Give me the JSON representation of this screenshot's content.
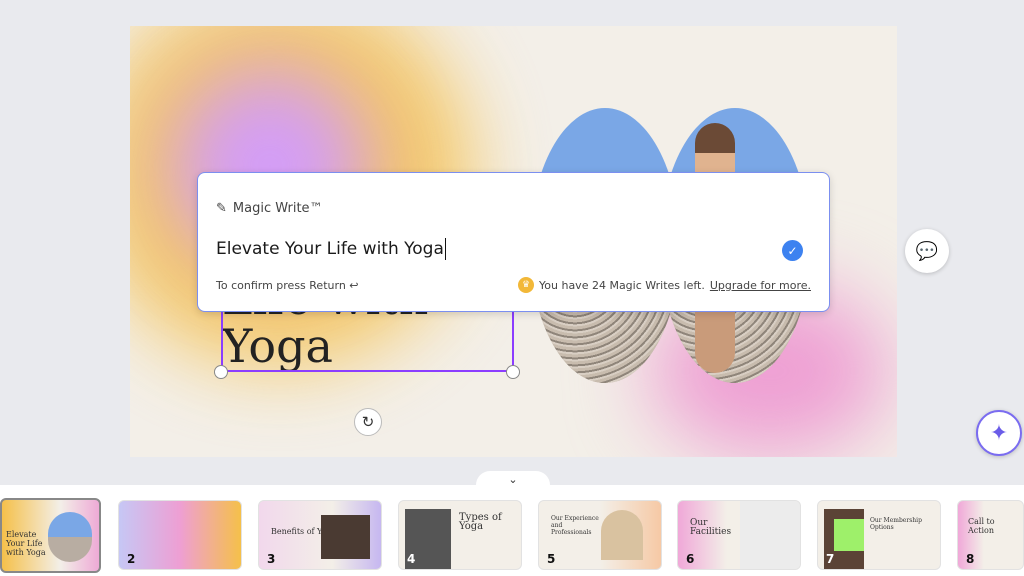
{
  "slide": {
    "title_partial": "Life with",
    "title_last": "Yoga"
  },
  "magic_write": {
    "label": "Magic Write™",
    "input_value": "Elevate Your Life with Yoga",
    "confirm_hint": "To confirm press Return ↩",
    "remaining": "You have 24 Magic Writes left.",
    "upgrade_link": "Upgrade for more."
  },
  "icons": {
    "wand": "✎",
    "check": "✓",
    "crown": "♛",
    "rotate": "↻",
    "comment_add": "💬",
    "sparkle": "✦",
    "chevron": "⌄"
  },
  "thumbnails": [
    {
      "num": "",
      "title": "Elevate Your Life with Yoga"
    },
    {
      "num": "2",
      "title": ""
    },
    {
      "num": "3",
      "title": "Benefits of Yoga"
    },
    {
      "num": "4",
      "title": "Types of Yoga"
    },
    {
      "num": "5",
      "title": "Our Experience and Professionals"
    },
    {
      "num": "6",
      "title": "Our Facilities"
    },
    {
      "num": "7",
      "title": "Our Membership Options"
    },
    {
      "num": "8",
      "title": "Call to Action"
    }
  ]
}
